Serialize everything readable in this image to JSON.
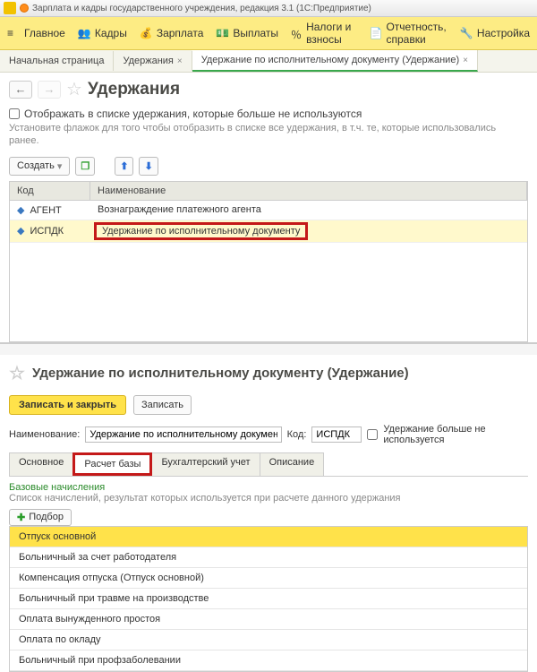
{
  "titlebar": "Зарплата и кадры государственного учреждения, редакция 3.1  (1С:Предприятие)",
  "mainmenu": {
    "home": "Главное",
    "personnel": "Кадры",
    "salary": "Зарплата",
    "payments": "Выплаты",
    "taxes": "Налоги и взносы",
    "reports": "Отчетность, справки",
    "settings": "Настройка"
  },
  "navtabs": {
    "start": "Начальная страница",
    "list": "Удержания",
    "doc": "Удержание по исполнительному документу (Удержание)"
  },
  "page1": {
    "title": "Удержания",
    "show_unused": "Отображать в списке удержания, которые больше не используются",
    "hint": "Установите флажок для того чтобы отобразить в списке все удержания, в т.ч. те, которые использовались ранее.",
    "create": "Создать",
    "cols": {
      "code": "Код",
      "name": "Наименование"
    },
    "rows": [
      {
        "code": "АГЕНТ",
        "name": "Вознаграждение платежного агента"
      },
      {
        "code": "ИСПДК",
        "name": "Удержание по исполнительному документу"
      }
    ]
  },
  "page2": {
    "title": "Удержание по исполнительному документу (Удержание)",
    "save_close": "Записать и закрыть",
    "save": "Записать",
    "name_label": "Наименование:",
    "name_value": "Удержание по исполнительному документу",
    "code_label": "Код:",
    "code_value": "ИСПДК",
    "unused_label": "Удержание больше не используется",
    "tabs": {
      "main": "Основное",
      "base": "Расчет базы",
      "acc": "Бухгалтерский учет",
      "desc": "Описание"
    },
    "base_header": "Базовые начисления",
    "base_desc": "Список начислений, результат которых используется при расчете данного удержания",
    "pick": "Подбор",
    "items": [
      "Отпуск основной",
      "Больничный за счет работодателя",
      "Компенсация отпуска (Отпуск основной)",
      "Больничный при травме на производстве",
      "Оплата вынужденного простоя",
      "Оплата по окладу",
      "Больничный при профзаболевании"
    ]
  }
}
